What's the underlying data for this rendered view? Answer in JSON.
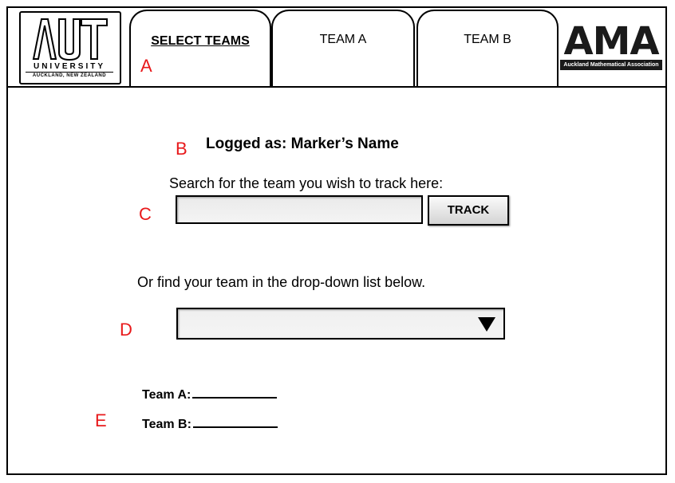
{
  "header": {
    "aut_logo": {
      "letters": "AUT",
      "university": "UNIVERSITY",
      "location": "AUCKLAND, NEW ZEALAND"
    },
    "tabs": [
      {
        "label": "SELECT TEAMS",
        "active": true
      },
      {
        "label": "TEAM A",
        "active": false
      },
      {
        "label": "TEAM B",
        "active": false
      }
    ],
    "ama_logo": {
      "letters": "AMA",
      "caption": "Auckland Mathematical Association"
    }
  },
  "markers": {
    "a": "A",
    "b": "B",
    "c": "C",
    "d": "D",
    "e": "E"
  },
  "main": {
    "logged_as": "Logged as: Marker’s Name",
    "search_prompt": "Search for the team you wish to track here:",
    "search_value": "",
    "track_label": "TRACK",
    "dropdown_prompt": "Or find your team in the drop-down list below.",
    "dropdown_value": "",
    "team_a_label": "Team A:",
    "team_b_label": "Team B:"
  },
  "colors": {
    "marker": "#e8191b",
    "border": "#000000"
  }
}
